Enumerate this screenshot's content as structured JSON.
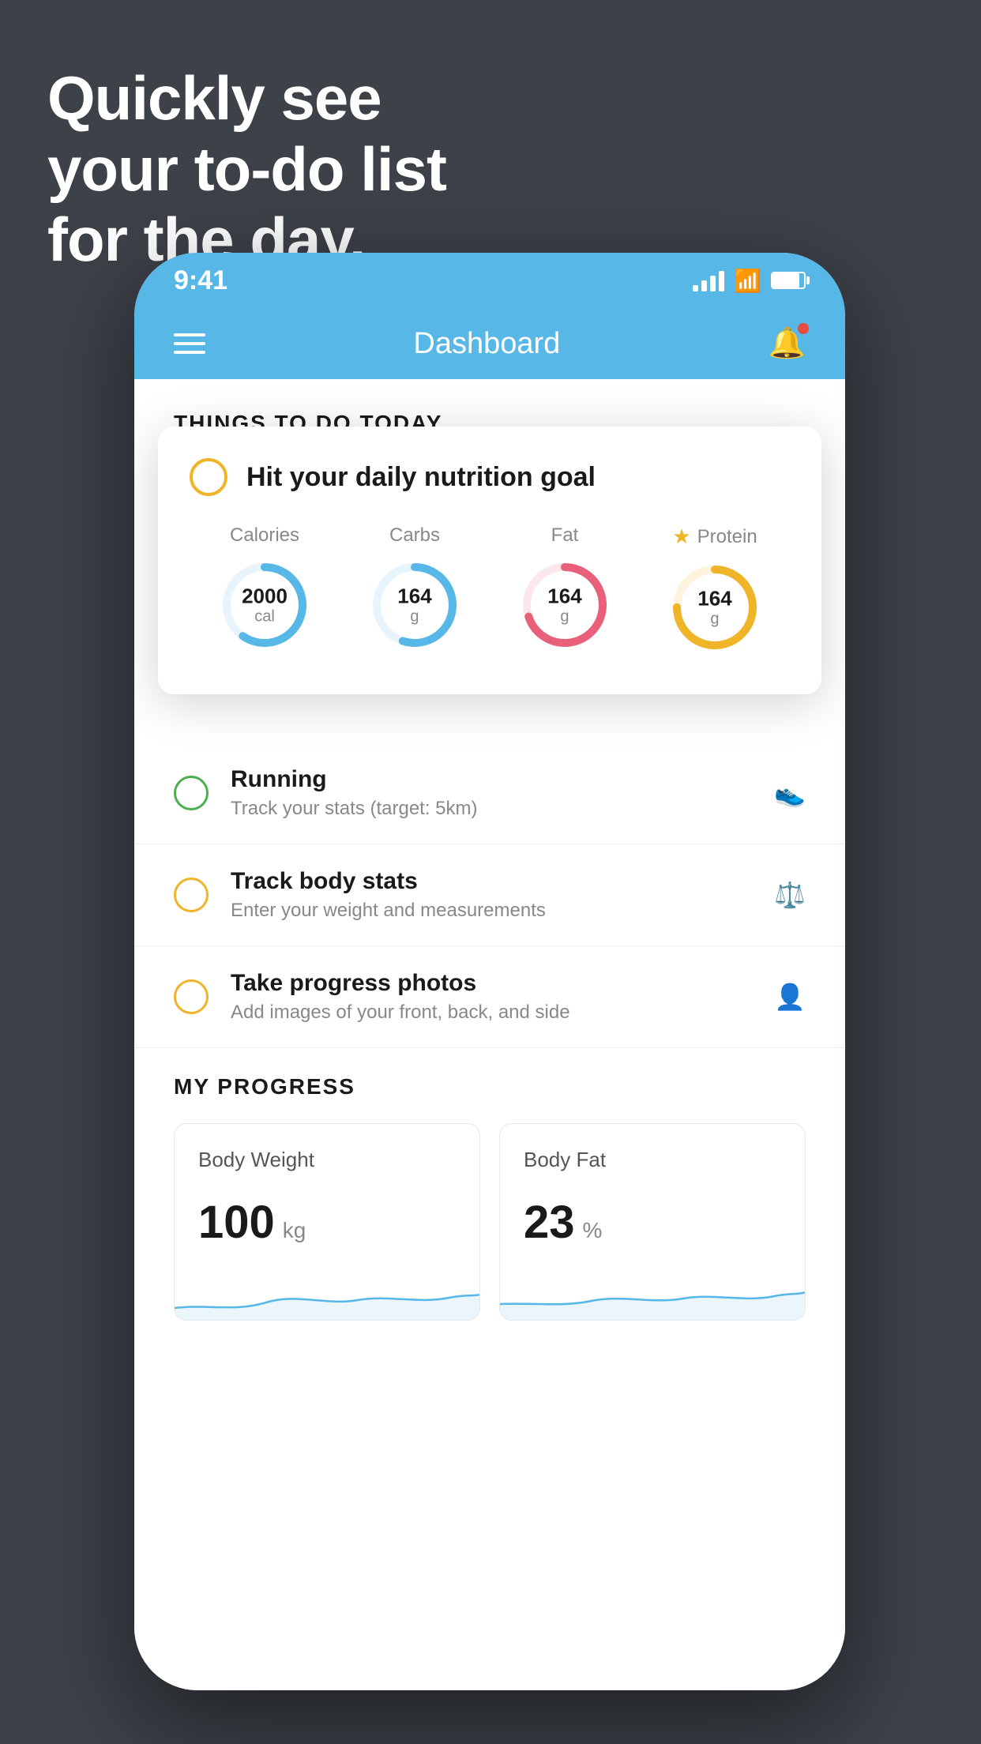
{
  "headline": {
    "line1": "Quickly see",
    "line2": "your to-do list",
    "line3": "for the day."
  },
  "statusBar": {
    "time": "9:41"
  },
  "header": {
    "title": "Dashboard"
  },
  "thingsToDo": {
    "sectionLabel": "THINGS TO DO TODAY"
  },
  "nutritionCard": {
    "checkLabel": "Hit your daily nutrition goal",
    "items": [
      {
        "label": "Calories",
        "value": "2000",
        "unit": "cal",
        "color": "#57b8e8",
        "pct": 60,
        "starred": false
      },
      {
        "label": "Carbs",
        "value": "164",
        "unit": "g",
        "color": "#57b8e8",
        "pct": 55,
        "starred": false
      },
      {
        "label": "Fat",
        "value": "164",
        "unit": "g",
        "color": "#e8607a",
        "pct": 70,
        "starred": false
      },
      {
        "label": "Protein",
        "value": "164",
        "unit": "g",
        "color": "#f0b429",
        "pct": 75,
        "starred": true
      }
    ]
  },
  "todoItems": [
    {
      "title": "Running",
      "sub": "Track your stats (target: 5km)",
      "circleColor": "green",
      "icon": "👟"
    },
    {
      "title": "Track body stats",
      "sub": "Enter your weight and measurements",
      "circleColor": "yellow",
      "icon": "⚖️"
    },
    {
      "title": "Take progress photos",
      "sub": "Add images of your front, back, and side",
      "circleColor": "yellow",
      "icon": "👤"
    }
  ],
  "progress": {
    "sectionLabel": "MY PROGRESS",
    "cards": [
      {
        "title": "Body Weight",
        "value": "100",
        "unit": "kg"
      },
      {
        "title": "Body Fat",
        "value": "23",
        "unit": "%"
      }
    ]
  }
}
